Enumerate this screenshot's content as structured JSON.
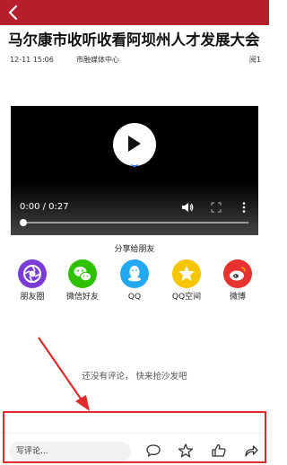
{
  "header": {
    "back_icon": "back-arrow-icon",
    "background": "#b51f2a"
  },
  "article": {
    "title": "马尔康市收听收看阿坝州人才发展大会",
    "date": "12-11 15:06",
    "source": "市融媒体中心",
    "reads": "阅1"
  },
  "video": {
    "time": "0:00 / 0:27",
    "progress": 0.0,
    "controls": [
      "play-icon",
      "volume-icon",
      "fullscreen-icon",
      "more-vertical-icon"
    ]
  },
  "share": {
    "title": "分享给朋友",
    "items": [
      {
        "label": "朋友圈",
        "icon": "moments-icon",
        "color": "#7a3bd6"
      },
      {
        "label": "微信好友",
        "icon": "wechat-icon",
        "color": "#2dc100"
      },
      {
        "label": "QQ",
        "icon": "qq-icon",
        "color": "#23a8f2"
      },
      {
        "label": "QQ空间",
        "icon": "qzone-icon",
        "color": "#f7c600"
      },
      {
        "label": "微博",
        "icon": "weibo-icon",
        "color": "#e8322f"
      }
    ]
  },
  "comments": {
    "empty_text": "还没有评论， 快来抢沙发吧"
  },
  "bottom_bar": {
    "comment_placeholder": "写评论...",
    "icons": [
      "comment-icon",
      "star-icon",
      "like-icon",
      "share-icon"
    ]
  },
  "annotation": {
    "color": "#e02b2b"
  }
}
